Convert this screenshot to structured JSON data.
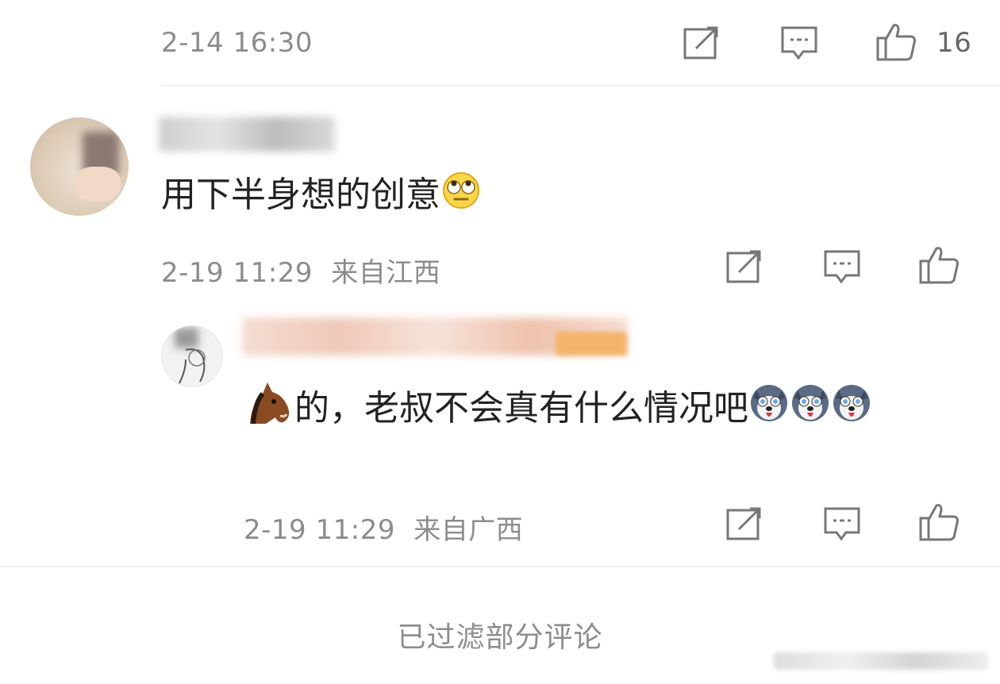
{
  "top_row": {
    "time": "2-14 16:30",
    "like_count": "16"
  },
  "comment1": {
    "text": "用下半身想的创意",
    "time": "2-19 11:29",
    "location": "来自江西"
  },
  "reply1": {
    "text": "的，老叔不会真有什么情况吧",
    "time": "2-19 11:29",
    "location": "来自广西"
  },
  "footer": {
    "filtered_notice": "已过滤部分评论"
  },
  "colors": {
    "meta_gray": "#8c8c8c",
    "icon_gray": "#777777",
    "divider": "#eeeeee"
  },
  "icons": [
    "share-icon",
    "comment-icon",
    "like-icon",
    "rolling-eyes-emoji",
    "horse-emoji",
    "husky-emoji"
  ]
}
